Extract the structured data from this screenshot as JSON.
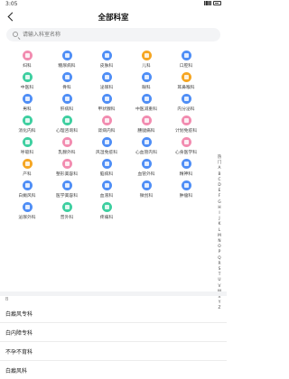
{
  "status": {
    "time": "3:05"
  },
  "header": {
    "title": "全部科室"
  },
  "search": {
    "placeholder": "请输入科室名称"
  },
  "departments": [
    {
      "label": "妇科",
      "color": "#f28cb0"
    },
    {
      "label": "糖尿病科",
      "color": "#4f8ef6"
    },
    {
      "label": "皮肤科",
      "color": "#4f8ef6"
    },
    {
      "label": "儿科",
      "color": "#f5a623"
    },
    {
      "label": "口腔科",
      "color": "#4f8ef6"
    },
    {
      "label": "中医科",
      "color": "#3ecfa0"
    },
    {
      "label": "骨科",
      "color": "#4f8ef6"
    },
    {
      "label": "泌尿科",
      "color": "#4f8ef6"
    },
    {
      "label": "眼科",
      "color": "#4f8ef6"
    },
    {
      "label": "耳鼻喉科",
      "color": "#f5a623"
    },
    {
      "label": "男科",
      "color": "#4f8ef6"
    },
    {
      "label": "肝病科",
      "color": "#4f8ef6"
    },
    {
      "label": "甲状腺科",
      "color": "#4f8ef6"
    },
    {
      "label": "中医减重科",
      "color": "#4f8ef6"
    },
    {
      "label": "内分泌科",
      "color": "#4f8ef6"
    },
    {
      "label": "消化内科",
      "color": "#3ecfa0"
    },
    {
      "label": "心理咨询科",
      "color": "#3ecfa0"
    },
    {
      "label": "肾病内科",
      "color": "#f28cb0"
    },
    {
      "label": "腰腿痛科",
      "color": "#f28cb0"
    },
    {
      "label": "计划免疫科",
      "color": "#f28cb0"
    },
    {
      "label": "呼吸科",
      "color": "#3ecfa0"
    },
    {
      "label": "乳腺外科",
      "color": "#f28cb0"
    },
    {
      "label": "风湿免疫科",
      "color": "#4f8ef6"
    },
    {
      "label": "心血管内科",
      "color": "#4f8ef6"
    },
    {
      "label": "心身医学科",
      "color": "#f28cb0"
    },
    {
      "label": "产科",
      "color": "#f5a623"
    },
    {
      "label": "整形美容科",
      "color": "#f28cb0"
    },
    {
      "label": "脑病科",
      "color": "#4f8ef6"
    },
    {
      "label": "血管外科",
      "color": "#4f8ef6"
    },
    {
      "label": "精神科",
      "color": "#4f8ef6"
    },
    {
      "label": "白癜风科",
      "color": "#4f8ef6"
    },
    {
      "label": "医学美容科",
      "color": "#4f8ef6"
    },
    {
      "label": "血液科",
      "color": "#4f8ef6"
    },
    {
      "label": "微创科",
      "color": "#4f8ef6"
    },
    {
      "label": "肿瘤科",
      "color": "#4f8ef6"
    },
    {
      "label": "泌尿外科",
      "color": "#4f8ef6"
    },
    {
      "label": "普外科",
      "color": "#3ecfa0"
    },
    {
      "label": "疼痛科",
      "color": "#3ecfa0"
    }
  ],
  "alphabet": [
    "热",
    "门",
    "A",
    "B",
    "C",
    "D",
    "E",
    "F",
    "G",
    "H",
    "I",
    "J",
    "K",
    "L",
    "M",
    "N",
    "O",
    "P",
    "Q",
    "R",
    "S",
    "T",
    "U",
    "V",
    "W",
    "X",
    "Y",
    "Z"
  ],
  "section_tag": "B",
  "list_items": [
    "白癜风专科",
    "白内障专科",
    "不孕不育科",
    "白癜风科"
  ]
}
